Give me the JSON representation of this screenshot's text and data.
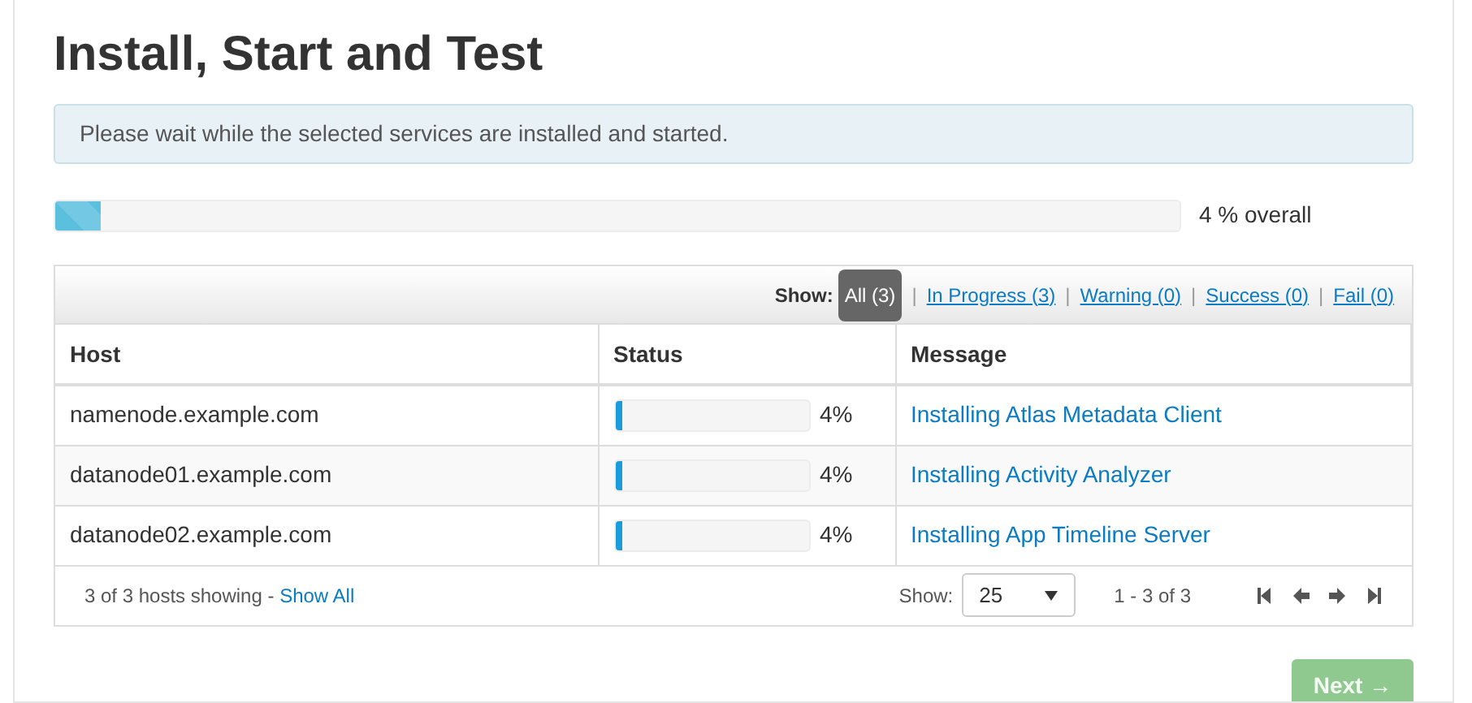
{
  "title": "Install, Start and Test",
  "alert": "Please wait while the selected services are installed and started.",
  "overall": {
    "level": 0.04,
    "reading": "4 % overall"
  },
  "filter": {
    "label": "Show:",
    "separator": "|",
    "options": [
      {
        "label": "All (3)",
        "selected": true
      },
      {
        "label": "In Progress (3)",
        "selected": false
      },
      {
        "label": "Warning (0)",
        "selected": false
      },
      {
        "label": "Success (0)",
        "selected": false
      },
      {
        "label": "Fail (0)",
        "selected": false
      }
    ]
  },
  "table": {
    "columns": [
      "Host",
      "Status",
      "Message"
    ],
    "rows": [
      {
        "host": "namenode.example.com",
        "level": 0.04,
        "reading": "4%",
        "message": "Installing Atlas Metadata Client"
      },
      {
        "host": "datanode01.example.com",
        "level": 0.04,
        "reading": "4%",
        "message": "Installing Activity Analyzer"
      },
      {
        "host": "datanode02.example.com",
        "level": 0.04,
        "reading": "4%",
        "message": "Installing App Timeline Server"
      }
    ]
  },
  "footer": {
    "summary": "3 of 3 hosts showing - ",
    "show_all": "Show All",
    "show_label": "Show:",
    "page_size": "25",
    "range": "1 - 3 of 3"
  },
  "next_button": {
    "label": "Next →",
    "disabled": true
  }
}
